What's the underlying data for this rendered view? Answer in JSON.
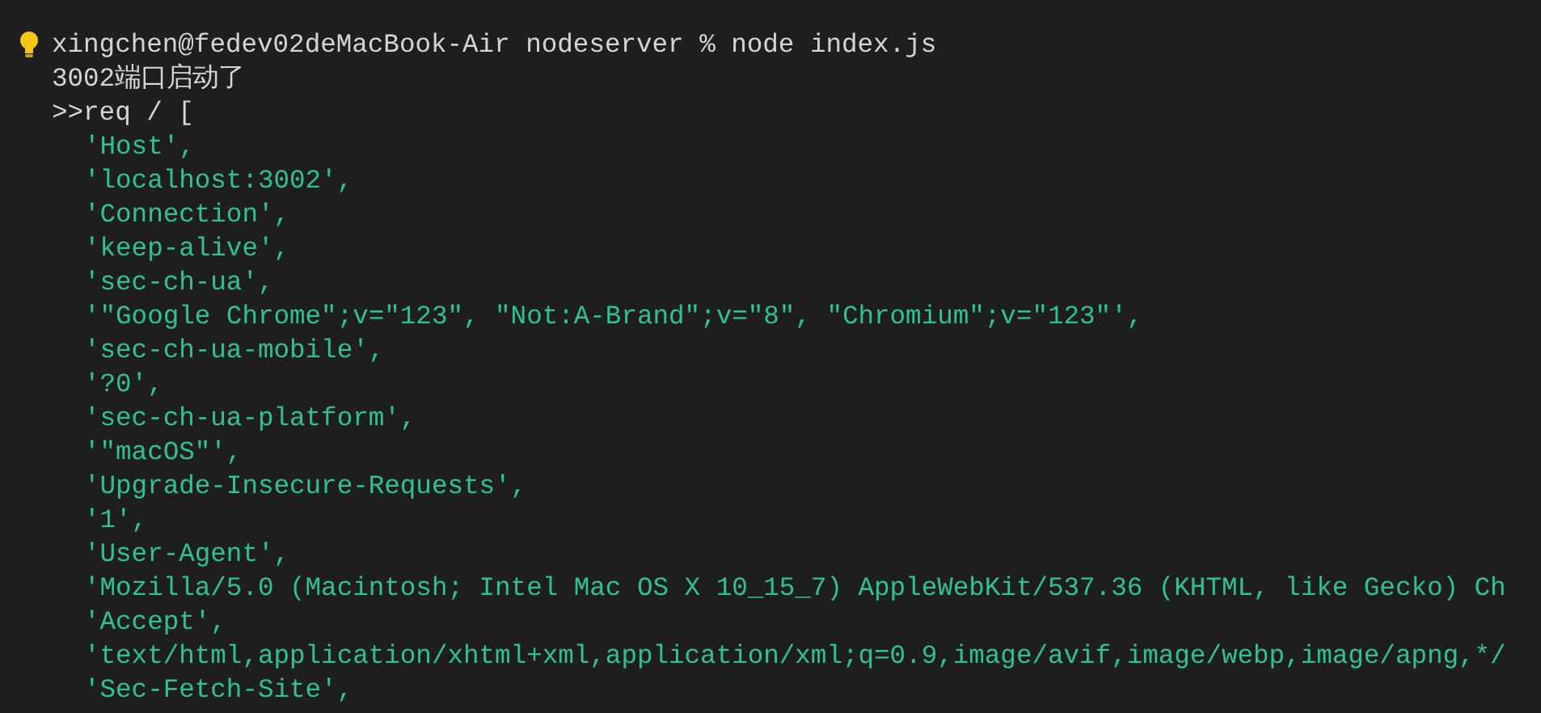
{
  "terminal": {
    "lines": [
      {
        "kind": "command",
        "text": "xingchen@fedev02deMacBook-Air nodeserver % node index.js"
      },
      {
        "kind": "output",
        "text": "3002端口启动了"
      },
      {
        "kind": "output",
        "text": ">>req / ["
      },
      {
        "kind": "string",
        "text": "'Host',"
      },
      {
        "kind": "string",
        "text": "'localhost:3002',"
      },
      {
        "kind": "string",
        "text": "'Connection',"
      },
      {
        "kind": "string",
        "text": "'keep-alive',"
      },
      {
        "kind": "string",
        "text": "'sec-ch-ua',"
      },
      {
        "kind": "string",
        "text": "'\"Google Chrome\";v=\"123\", \"Not:A-Brand\";v=\"8\", \"Chromium\";v=\"123\"',"
      },
      {
        "kind": "string",
        "text": "'sec-ch-ua-mobile',"
      },
      {
        "kind": "string",
        "text": "'?0',"
      },
      {
        "kind": "string",
        "text": "'sec-ch-ua-platform',"
      },
      {
        "kind": "string",
        "text": "'\"macOS\"',"
      },
      {
        "kind": "string",
        "text": "'Upgrade-Insecure-Requests',"
      },
      {
        "kind": "string",
        "text": "'1',"
      },
      {
        "kind": "string",
        "text": "'User-Agent',"
      },
      {
        "kind": "string",
        "text": "'Mozilla/5.0 (Macintosh; Intel Mac OS X 10_15_7) AppleWebKit/537.36 (KHTML, like Gecko) Ch"
      },
      {
        "kind": "string",
        "text": "'Accept',"
      },
      {
        "kind": "string",
        "text": "'text/html,application/xhtml+xml,application/xml;q=0.9,image/avif,image/webp,image/apng,*/"
      },
      {
        "kind": "string",
        "text": "'Sec-Fetch-Site',"
      }
    ]
  }
}
